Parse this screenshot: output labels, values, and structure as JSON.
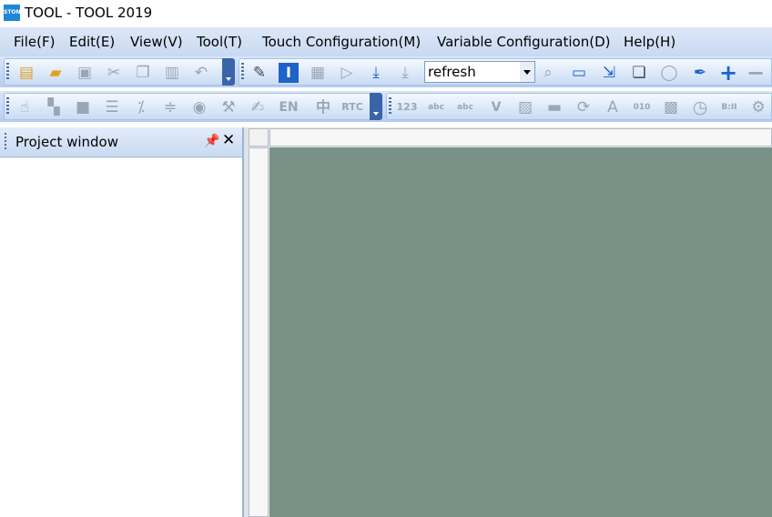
{
  "window": {
    "logo_text": "STONE",
    "title": "TOOL - TOOL 2019"
  },
  "menu": [
    "File(F)",
    "Edit(E)",
    "View(V)",
    "Tool(T)",
    "Touch Configuration(M)",
    "Variable Configuration(D)",
    "Help(H)"
  ],
  "toolbar1": {
    "icons": [
      "new-project-icon",
      "open-folder-icon",
      "save-icon",
      "cut-icon",
      "copy-icon",
      "paste-icon",
      "undo-icon"
    ]
  },
  "toolbar2": {
    "icons": [
      "tools-icon",
      "text-cursor-icon",
      "image-icon",
      "play-icon",
      "download-icon",
      "download-disabled-icon"
    ],
    "combo_value": "refresh",
    "icons_after": [
      "preview-icon",
      "serial-port-icon",
      "export-icon",
      "window-icon",
      "zoom-icon",
      "dropper-icon",
      "plus-icon",
      "minus-icon"
    ]
  },
  "toolbar3": {
    "labels": {
      "en": "EN",
      "zh": "中",
      "rtc": "RTC"
    }
  },
  "toolbar4": {
    "labels": {
      "num": "123",
      "abc1": "abc",
      "abc2": "abc",
      "v": "V",
      "bits": "010",
      "clock": "B:II"
    }
  },
  "project_window": {
    "title": "Project window"
  },
  "colors": {
    "canvas": "#7a9188",
    "menubar": "#c7d9f2",
    "accent": "#1d63c8"
  }
}
